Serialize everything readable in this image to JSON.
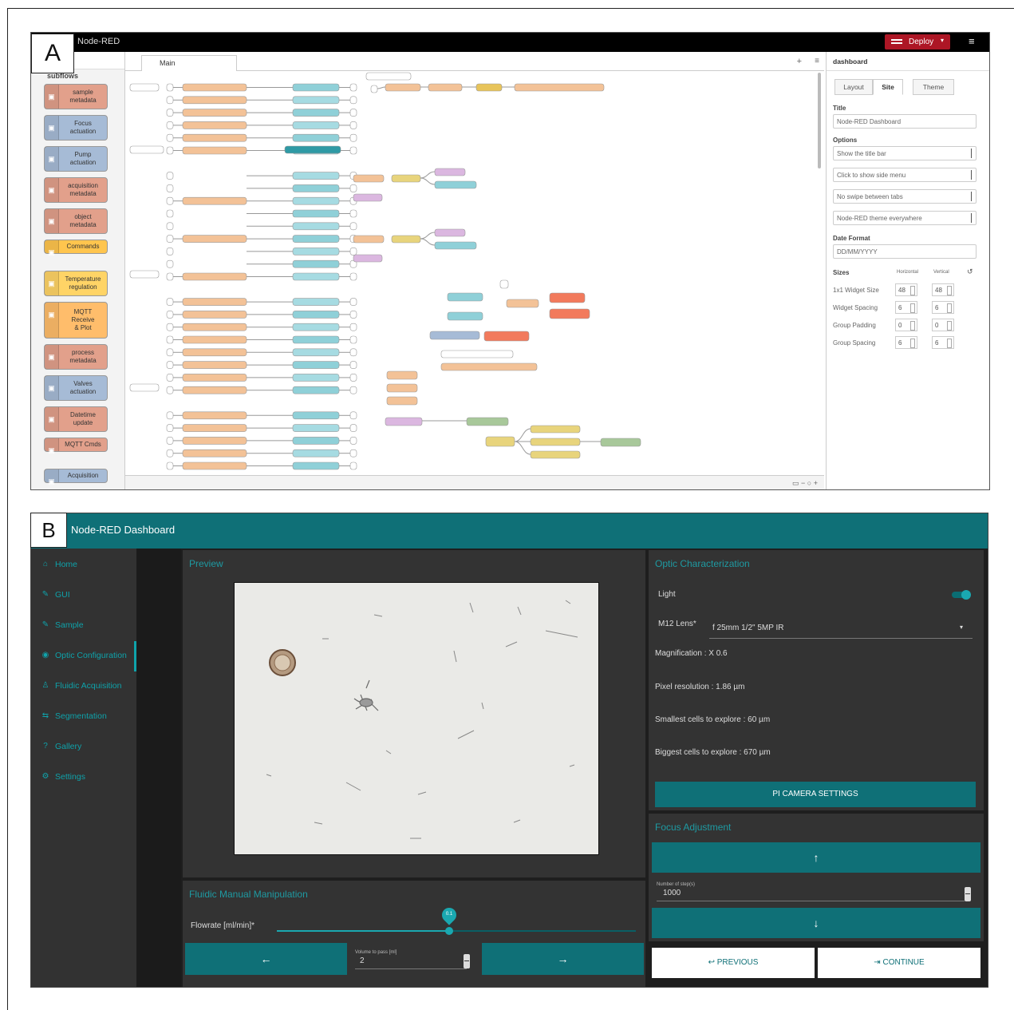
{
  "labels": {
    "a": "A",
    "b": "B"
  },
  "node_red": {
    "title": "Node-RED",
    "deploy_label": "Deploy",
    "palette_category": "subflows",
    "palette_nodes": [
      {
        "label": "sample\nmetadata",
        "color": "#e2a08b"
      },
      {
        "label": "Focus\nactuation",
        "color": "#a6bbd6"
      },
      {
        "label": "Pump\nactuation",
        "color": "#a6bbd6"
      },
      {
        "label": "acquisition\nmetadata",
        "color": "#e2a08b"
      },
      {
        "label": "object\nmetadata",
        "color": "#e2a08b"
      },
      {
        "label": "Commands",
        "color": "#ffc54e"
      },
      {
        "label": "Temperature\nregulation",
        "color": "#ffd466"
      },
      {
        "label": "MQTT\nReceive\n& Plot",
        "color": "#ffbd6b"
      },
      {
        "label": "process\nmetadata",
        "color": "#e2a08b"
      },
      {
        "label": "Valves\nactuation",
        "color": "#a6bbd6"
      },
      {
        "label": "Datetime\nupdate",
        "color": "#e2a08b"
      },
      {
        "label": "MQTT Cmds",
        "color": "#e2a08b"
      },
      {
        "label": "Acquisition",
        "color": "#a6bbd6"
      }
    ],
    "tab_label": "Main",
    "sidebar": {
      "header": "dashboard",
      "tabs": [
        "Layout",
        "Site",
        "Theme"
      ],
      "title_label": "Title",
      "title_value": "Node-RED Dashboard",
      "options_label": "Options",
      "options": [
        "Show the title bar",
        "Click to show side menu",
        "No swipe between tabs",
        "Node-RED theme everywhere"
      ],
      "date_label": "Date Format",
      "date_value": "DD/MM/YYYY",
      "sizes_label": "Sizes",
      "col_h": "Horizontal",
      "col_v": "Vertical",
      "sizes": [
        {
          "label": "1x1 Widget Size",
          "h": "48",
          "v": "48"
        },
        {
          "label": "Widget Spacing",
          "h": "6",
          "v": "6"
        },
        {
          "label": "Group Padding",
          "h": "0",
          "v": "0"
        },
        {
          "label": "Group Spacing",
          "h": "6",
          "v": "6"
        }
      ]
    }
  },
  "dashboard": {
    "title": "Node-RED Dashboard",
    "nav": [
      {
        "icon": "⌂",
        "label": "Home"
      },
      {
        "icon": "✎",
        "label": "GUI"
      },
      {
        "icon": "✎",
        "label": "Sample"
      },
      {
        "icon": "◉",
        "label": "Optic Configuration"
      },
      {
        "icon": "♙",
        "label": "Fluidic Acquisition"
      },
      {
        "icon": "⇆",
        "label": "Segmentation"
      },
      {
        "icon": "?",
        "label": "Gallery"
      },
      {
        "icon": "⚙",
        "label": "Settings"
      }
    ],
    "preview_title": "Preview",
    "fluidic_title": "Fluidic Manual Manipulation",
    "flowrate_label": "Flowrate [ml/min]*",
    "flowrate_value": "0.1",
    "flowrate_fraction": 0.48,
    "volume_label": "Volume to pass [ml]",
    "volume_value": "2",
    "optic_title": "Optic Characterization",
    "light_label": "Light",
    "lens_label": "M12 Lens*",
    "lens_value": "f 25mm 1/2\" 5MP IR",
    "magnification": "Magnification : X 0.6",
    "pixel_res": "Pixel resolution : 1.86 µm",
    "smallest": "Smallest cells to explore : 60 µm",
    "biggest": "Biggest cells to explore : 670 µm",
    "camera_btn": "PI CAMERA SETTINGS",
    "focus_title": "Focus Adjustment",
    "steps_label": "Number of step(s)",
    "steps_value": "1000",
    "prev_btn": "PREVIOUS",
    "continue_btn": "CONTINUE"
  }
}
